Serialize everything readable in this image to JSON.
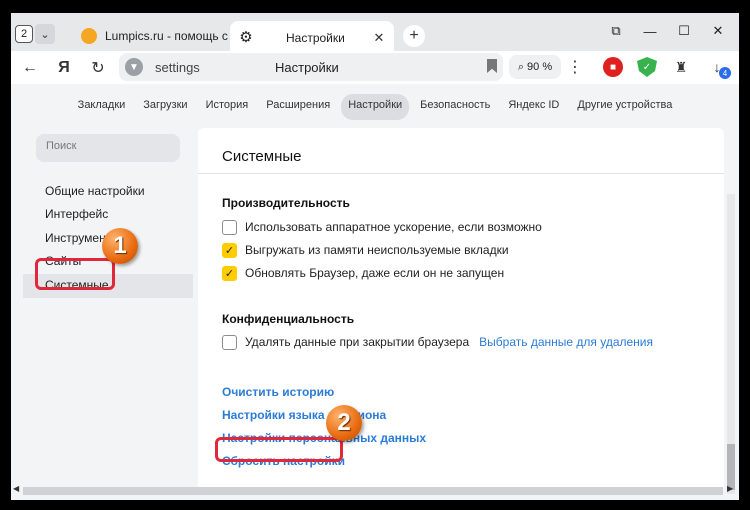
{
  "tabs": {
    "counter": "2",
    "items": [
      {
        "title": "Lumpics.ru - помощь с ко",
        "active": false
      },
      {
        "title": "Настройки",
        "active": true
      }
    ],
    "new_tab": "+"
  },
  "window_controls": {
    "pin": "⧉",
    "minimize": "—",
    "maximize": "☐",
    "close": "✕"
  },
  "address": {
    "url": "settings",
    "page_title": "Настройки",
    "zoom": "90 %"
  },
  "extensions": {
    "downloads_badge": "4"
  },
  "topnav": [
    "Закладки",
    "Загрузки",
    "История",
    "Расширения",
    "Настройки",
    "Безопасность",
    "Яндекс ID",
    "Другие устройства"
  ],
  "sidebar": {
    "search_placeholder": "Поиск",
    "items": [
      {
        "label": "Общие настройки"
      },
      {
        "label": "Интерфейс"
      },
      {
        "label": "Инструменты"
      },
      {
        "label": "Сайты"
      },
      {
        "label": "Системные",
        "active": true
      }
    ]
  },
  "panel": {
    "title": "Системные",
    "performance": {
      "heading": "Производительность",
      "options": [
        {
          "label": "Использовать аппаратное ускорение, если возможно",
          "checked": false
        },
        {
          "label": "Выгружать из памяти неиспользуемые вкладки",
          "checked": true
        },
        {
          "label": "Обновлять Браузер, даже если он не запущен",
          "checked": true
        }
      ]
    },
    "privacy": {
      "heading": "Конфиденциальность",
      "option": {
        "label": "Удалять данные при закрытии браузера",
        "checked": false
      },
      "link": "Выбрать данные для удаления"
    },
    "links": [
      "Очистить историю",
      "Настройки языка и региона",
      "Настройки персональных данных",
      "Сбросить настройки"
    ]
  },
  "annotations": {
    "marker_1": "1",
    "marker_2": "2",
    "color": "#e0283a"
  }
}
